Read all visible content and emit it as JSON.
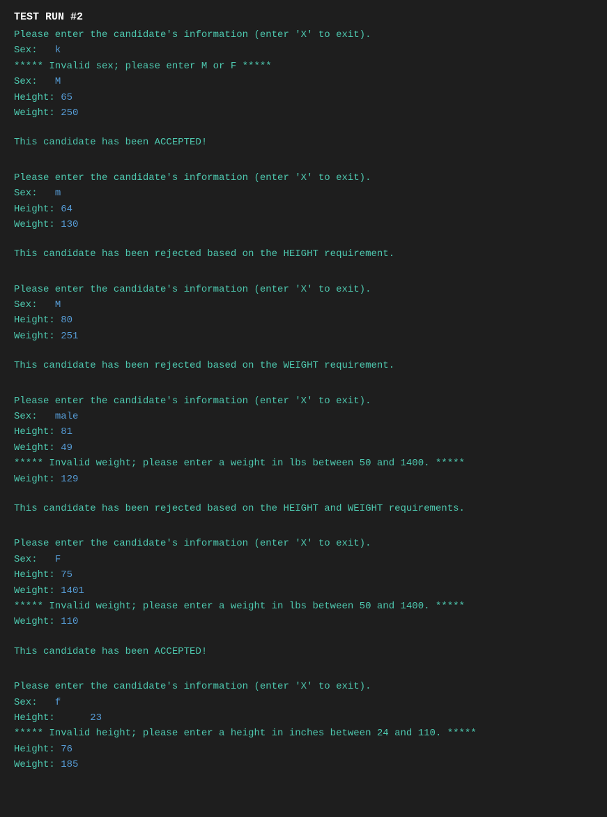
{
  "title": "TEST RUN #2",
  "blocks": [
    {
      "prompt": "Please enter the candidate's information (enter 'X' to exit).",
      "lines": [
        {
          "label": "Sex:   ",
          "value": "k",
          "type": "input"
        },
        {
          "label": "***** Invalid sex; please enter M or F *****",
          "value": "",
          "type": "error"
        },
        {
          "label": "Sex:   ",
          "value": "M",
          "type": "input"
        },
        {
          "label": "Height: ",
          "value": "65",
          "type": "input"
        },
        {
          "label": "Weight: ",
          "value": "250",
          "type": "input"
        }
      ],
      "result": "This candidate has been ACCEPTED!",
      "resultType": "accepted"
    },
    {
      "prompt": "Please enter the candidate's information (enter 'X' to exit).",
      "lines": [
        {
          "label": "Sex:   ",
          "value": "m",
          "type": "input"
        },
        {
          "label": "Height: ",
          "value": "64",
          "type": "input"
        },
        {
          "label": "Weight: ",
          "value": "130",
          "type": "input"
        }
      ],
      "result": "This candidate has been rejected based on the HEIGHT requirement.",
      "resultType": "rejected"
    },
    {
      "prompt": "Please enter the candidate's information (enter 'X' to exit).",
      "lines": [
        {
          "label": "Sex:   ",
          "value": "M",
          "type": "input"
        },
        {
          "label": "Height: ",
          "value": "80",
          "type": "input"
        },
        {
          "label": "Weight: ",
          "value": "251",
          "type": "input"
        }
      ],
      "result": "This candidate has been rejected based on the WEIGHT requirement.",
      "resultType": "rejected"
    },
    {
      "prompt": "Please enter the candidate's information (enter 'X' to exit).",
      "lines": [
        {
          "label": "Sex:   ",
          "value": "male",
          "type": "input"
        },
        {
          "label": "Height: ",
          "value": "81",
          "type": "input"
        },
        {
          "label": "Weight: ",
          "value": "49",
          "type": "input"
        },
        {
          "label": "***** Invalid weight; please enter a weight in lbs between 50 and 1400. *****",
          "value": "",
          "type": "error"
        },
        {
          "label": "Weight: ",
          "value": "129",
          "type": "input"
        }
      ],
      "result": "This candidate has been rejected based on the HEIGHT and WEIGHT requirements.",
      "resultType": "rejected"
    },
    {
      "prompt": "Please enter the candidate's information (enter 'X' to exit).",
      "lines": [
        {
          "label": "Sex:   ",
          "value": "F",
          "type": "input"
        },
        {
          "label": "Height: ",
          "value": "75",
          "type": "input"
        },
        {
          "label": "Weight: ",
          "value": "1401",
          "type": "input"
        },
        {
          "label": "***** Invalid weight; please enter a weight in lbs between 50 and 1400. *****",
          "value": "",
          "type": "error"
        },
        {
          "label": "Weight: ",
          "value": "110",
          "type": "input"
        }
      ],
      "result": "This candidate has been ACCEPTED!",
      "resultType": "accepted"
    },
    {
      "prompt": "Please enter the candidate's information (enter 'X' to exit).",
      "lines": [
        {
          "label": "Sex:   ",
          "value": "f",
          "type": "input"
        },
        {
          "label": "Height:      ",
          "value": "23",
          "type": "input"
        },
        {
          "label": "***** Invalid height; please enter a height in inches between 24 and 110. *****",
          "value": "",
          "type": "error"
        },
        {
          "label": "Height: ",
          "value": "76",
          "type": "input"
        },
        {
          "label": "Weight: ",
          "value": "185",
          "type": "input"
        }
      ],
      "result": null,
      "resultType": null
    }
  ]
}
